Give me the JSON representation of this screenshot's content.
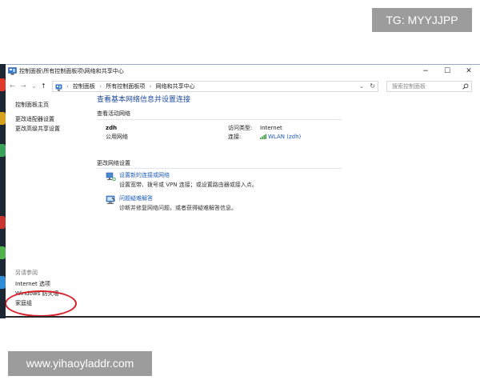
{
  "watermarks": {
    "tg": "TG: MYYJJPP",
    "site": "www.yihaoyladdr.com"
  },
  "colors": {
    "link": "#1e5bb8",
    "heading": "#1e4a9c",
    "highlight_ellipse": "#d8202a",
    "desktop": "#1d2733"
  },
  "window": {
    "title": "控制面板\\所有控制面板项\\网络和共享中心",
    "icon": "control-panel-icon",
    "controls": {
      "minimize": "−",
      "maximize": "☐",
      "close": "✕"
    }
  },
  "addressbar": {
    "nav": {
      "back": "←",
      "forward": "→",
      "history": "⌄",
      "up": "↑"
    },
    "location_icon": "control-panel-icon",
    "breadcrumbs": [
      "控制面板",
      "所有控制面板项",
      "网络和共享中心"
    ],
    "separator": "›",
    "dropdown": "⌄",
    "refresh": "↻",
    "search_placeholder": "搜索控制面板",
    "search_icon": "search-icon"
  },
  "sidebar": {
    "home": "控制面板主页",
    "links": [
      "更改适配器设置",
      "更改高级共享设置"
    ],
    "see_also_heading": "另请参阅",
    "see_also": [
      "Internet 选项",
      "Windows 防火墙",
      "家庭组"
    ]
  },
  "main": {
    "title": "查看基本网络信息并设置连接",
    "active_networks_heading": "查看活动网络",
    "network": {
      "name": "zdh",
      "category": "公用网络",
      "access_type_label": "访问类型:",
      "access_type_value": "Internet",
      "connections_label": "连接:",
      "connection_value": "WLAN (zdh)",
      "connection_icon": "wifi-signal-icon"
    },
    "change_settings_heading": "更改网络设置",
    "tasks": [
      {
        "icon": "network-setup-icon",
        "link": "设置新的连接或网络",
        "desc": "设置宽带、拨号或 VPN 连接；或设置路由器或接入点。"
      },
      {
        "icon": "troubleshoot-icon",
        "link": "问题疑难解答",
        "desc": "诊断并修复网络问题，或者获得疑难解答信息。"
      }
    ]
  }
}
